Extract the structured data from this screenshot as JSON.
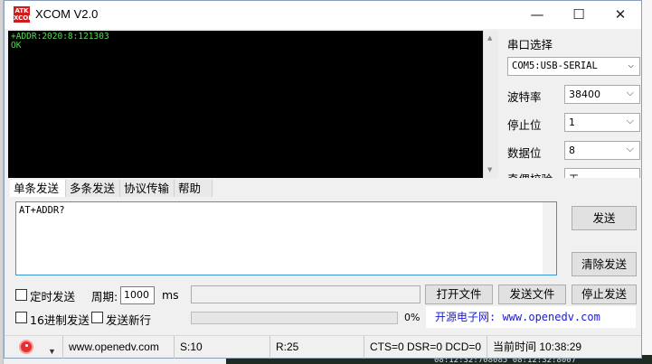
{
  "window": {
    "title": "XCOM V2.0",
    "logo_text": "ATK XCOM"
  },
  "controls": {
    "minimize": "—",
    "maximize": "☐",
    "close": "✕"
  },
  "receive": {
    "lines": [
      "+ADDR:2020:8:121303",
      "OK"
    ]
  },
  "serial": {
    "section_label": "串口选择",
    "port": "COM5:USB-SERIAL",
    "baud_label": "波特率",
    "baud": "38400",
    "stop_label": "停止位",
    "stop": "1",
    "data_label": "数据位",
    "data": "8",
    "parity_label": "奇偶校验",
    "parity": "无"
  },
  "tabs": [
    "单条发送",
    "多条发送",
    "协议传输",
    "帮助"
  ],
  "send": {
    "text": "AT+ADDR?",
    "send_button": "发送",
    "clear_button": "清除发送"
  },
  "options": {
    "timed_send": "定时发送",
    "period_label": "周期:",
    "period_value": "1000",
    "period_unit": "ms",
    "hex_send": "16进制发送",
    "newline_send": "发送新行",
    "open_file": "打开文件",
    "send_file": "发送文件",
    "stop_send": "停止发送",
    "progress_pct": "0%",
    "promo": "开源电子网: www.openedv.com"
  },
  "status": {
    "url": "www.openedv.com",
    "sent": "S:10",
    "received": "R:25",
    "lines": "CTS=0 DSR=0 DCD=0",
    "time": "当前时间 10:38:29"
  },
  "background": {
    "bottom_text": "08:12:32:708085    08:12:32:8007"
  }
}
